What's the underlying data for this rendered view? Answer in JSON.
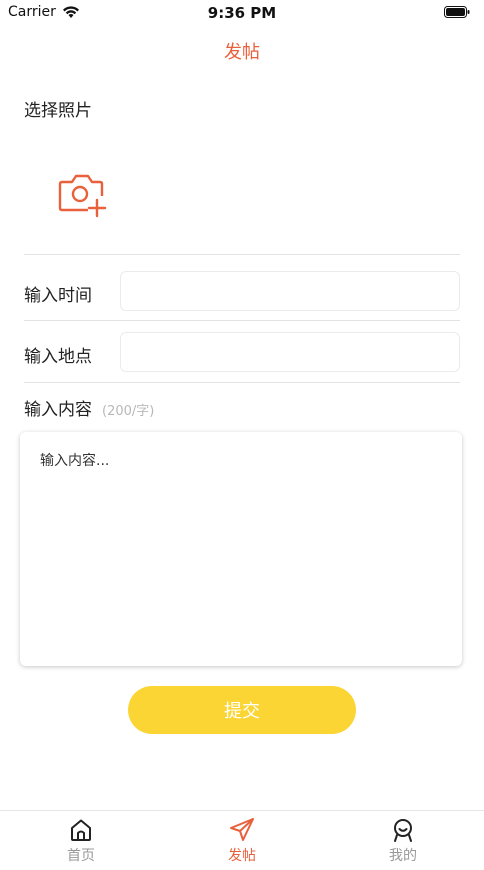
{
  "status_bar": {
    "carrier": "Carrier",
    "time": "9:36 PM"
  },
  "nav": {
    "title": "发帖"
  },
  "photo": {
    "label": "选择照片",
    "icon": "camera-add-icon"
  },
  "form": {
    "time_label": "输入时间",
    "time_value": "",
    "place_label": "输入地点",
    "place_value": "",
    "content_label": "输入内容",
    "content_limit": "(200/字)",
    "content_placeholder": "输入内容..."
  },
  "submit": {
    "label": "提交"
  },
  "tabs": [
    {
      "label": "首页",
      "icon": "home-icon",
      "active": false
    },
    {
      "label": "发帖",
      "icon": "send-icon",
      "active": true
    },
    {
      "label": "我的",
      "icon": "profile-icon",
      "active": false
    }
  ],
  "colors": {
    "accent": "#E8613C",
    "button": "#FBD533",
    "inactive": "#999999"
  }
}
